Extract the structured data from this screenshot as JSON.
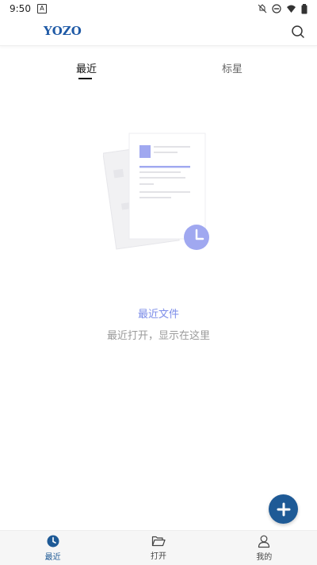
{
  "status_bar": {
    "time": "9:50",
    "notification_badge": "A"
  },
  "header": {
    "logo_text": "YOZO",
    "search_icon": "search-icon"
  },
  "tabs": [
    {
      "label": "最近",
      "active": true
    },
    {
      "label": "标星",
      "active": false
    }
  ],
  "empty_state": {
    "title": "最近文件",
    "subtitle": "最近打开，显示在这里"
  },
  "fab": {
    "icon": "plus-icon"
  },
  "bottom_nav": [
    {
      "label": "最近",
      "icon": "clock-icon",
      "active": true
    },
    {
      "label": "打开",
      "icon": "folder-open-icon",
      "active": false
    },
    {
      "label": "我的",
      "icon": "user-icon",
      "active": false
    }
  ],
  "colors": {
    "accent": "#1e5a96",
    "empty_title": "#7b8ce8",
    "illustration": "#a0a8f0"
  }
}
